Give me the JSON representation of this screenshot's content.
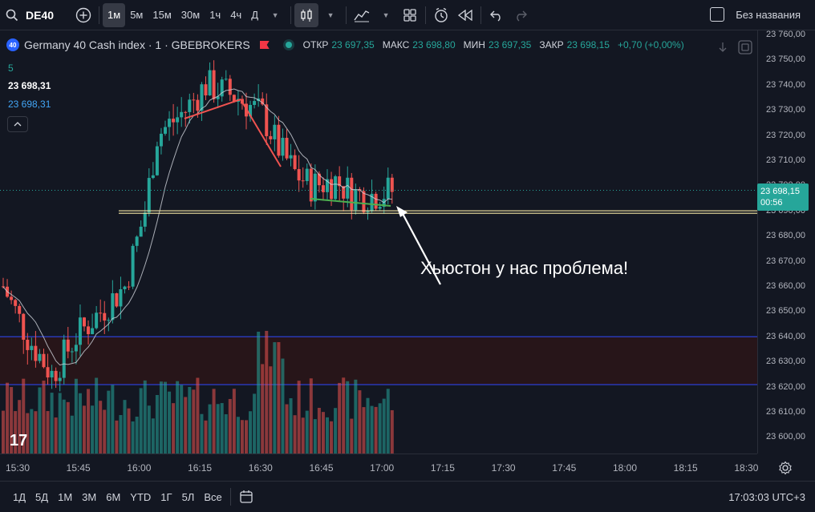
{
  "toolbar": {
    "symbol": "DE40",
    "intervals": [
      "1м",
      "5м",
      "15м",
      "30м",
      "1ч",
      "4ч",
      "Д"
    ],
    "active_interval": "1м",
    "layout_name": "Без названия"
  },
  "legend": {
    "title": "Germany 40 Cash index · 1 · GBEBROKERS",
    "badge": "40",
    "open_label": "ОТКР",
    "open": "23 697,35",
    "high_label": "МАКС",
    "high": "23 698,80",
    "low_label": "МИН",
    "low": "23 697,35",
    "close_label": "ЗАКР",
    "close": "23 698,15",
    "change": "+0,70 (+0,00%)",
    "indicator_len": "5",
    "value1": "23 698,31",
    "value2": "23 698,31"
  },
  "price_scale": {
    "labels": [
      "23 760,00",
      "23 750,00",
      "23 740,00",
      "23 730,00",
      "23 720,00",
      "23 710,00",
      "23 700,00",
      "23 690,00",
      "23 680,00",
      "23 670,00",
      "23 660,00",
      "23 650,00",
      "23 640,00",
      "23 630,00",
      "23 620,00",
      "23 610,00",
      "23 600,00"
    ],
    "last_price": "23 698,15",
    "countdown": "00:56"
  },
  "time_scale": {
    "labels": [
      "15:30",
      "15:45",
      "16:00",
      "16:15",
      "16:30",
      "16:45",
      "17:00",
      "17:15",
      "17:30",
      "17:45",
      "18:00",
      "18:15",
      "18:30"
    ]
  },
  "bottom": {
    "ranges": [
      "1Д",
      "5Д",
      "1М",
      "3М",
      "6М",
      "YTD",
      "1Г",
      "5Л",
      "Все"
    ],
    "clock": "17:03:03 UTC+3"
  },
  "annotation": "Хьюстон у нас проблема!",
  "colors": {
    "up": "#26a69a",
    "down": "#ef5350",
    "background": "#131722",
    "hline": "#f5e6a3",
    "zone_line": "#2c3fd1"
  },
  "chart_data": {
    "type": "candlestick",
    "x_range": [
      "15:26",
      "18:30"
    ],
    "y_range": [
      23593,
      23763
    ],
    "horizontal_levels": [
      23689,
      23690
    ],
    "zone": [
      23621,
      23640
    ],
    "last_price": 23698.15
  }
}
